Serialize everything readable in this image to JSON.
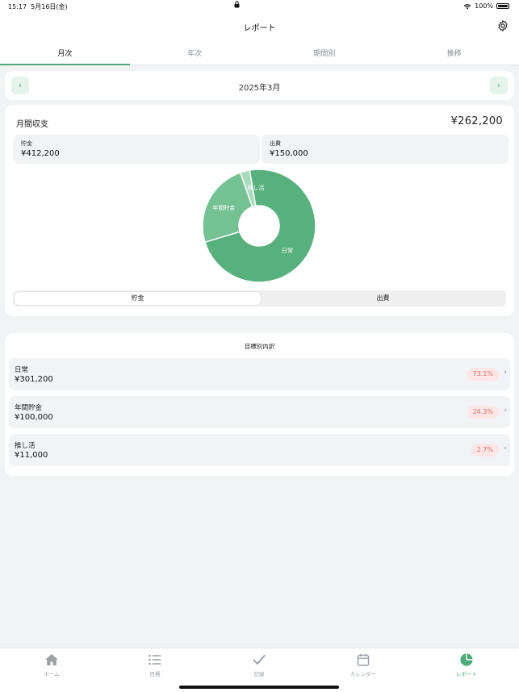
{
  "status_bar": {
    "time": "15:17",
    "date": "5月16日(金)",
    "battery": "100%"
  },
  "nav": {
    "title": "レポート"
  },
  "tabs": [
    {
      "label": "月次",
      "active": true
    },
    {
      "label": "年次",
      "active": false
    },
    {
      "label": "期間別",
      "active": false
    },
    {
      "label": "推移",
      "active": false
    }
  ],
  "month_selector": {
    "label": "2025年3月",
    "prev": "‹",
    "next": "›"
  },
  "summary": {
    "title": "月間収支",
    "total": "¥262,200",
    "savings": {
      "label": "貯金",
      "value": "¥412,200"
    },
    "expenses": {
      "label": "出費",
      "value": "¥150,000"
    }
  },
  "chart_data": {
    "type": "pie",
    "categories": [
      "日常",
      "年間貯金",
      "推し活"
    ],
    "values": [
      73.1,
      24.3,
      2.7
    ],
    "colors": [
      "#57b07d",
      "#74c194",
      "#a9d9bd"
    ]
  },
  "segment": {
    "left_label": "貯金",
    "right_label": "出費",
    "selected": "貯金"
  },
  "breakdown": {
    "title": "目標別内訳",
    "rows": [
      {
        "name": "日常",
        "amount": "¥301,200",
        "percent": "73.1%"
      },
      {
        "name": "年間貯金",
        "amount": "¥100,000",
        "percent": "24.3%"
      },
      {
        "name": "推し活",
        "amount": "¥11,000",
        "percent": "2.7%"
      }
    ]
  },
  "tab_bar": {
    "items": [
      {
        "label": "ホーム",
        "icon": "home-icon",
        "active": false
      },
      {
        "label": "目標",
        "icon": "list-icon",
        "active": false
      },
      {
        "label": "記録",
        "icon": "checkmark-icon",
        "active": false
      },
      {
        "label": "カレンダー",
        "icon": "calendar-icon",
        "active": false
      },
      {
        "label": "レポート",
        "icon": "pie-chart-icon",
        "active": true
      }
    ],
    "accent": "#4eaa78",
    "inactive": "#9aa0a6"
  }
}
